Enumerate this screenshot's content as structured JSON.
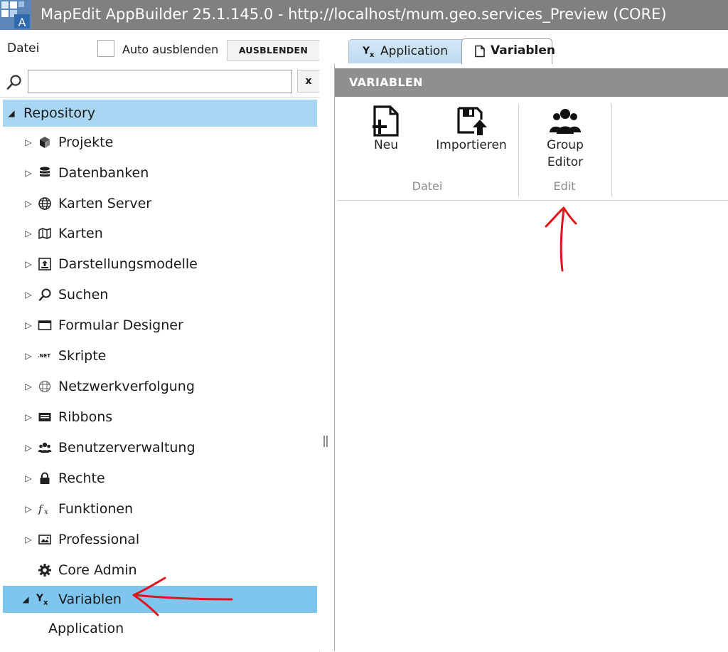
{
  "window": {
    "title": "MapEdit AppBuilder 25.1.145.0   -   http://localhost/mum.geo.services_Preview (CORE)"
  },
  "left_panel": {
    "datei_label": "Datei",
    "auto_hide_label": "Auto ausblenden",
    "hide_button": "AUSBLENDEN",
    "search_value": "",
    "clear_button": "x"
  },
  "tree": {
    "root": "Repository",
    "items": [
      {
        "label": "Projekte",
        "icon": "cube-icon"
      },
      {
        "label": "Datenbanken",
        "icon": "database-icon"
      },
      {
        "label": "Karten Server",
        "icon": "globe-icon"
      },
      {
        "label": "Karten",
        "icon": "map-icon"
      },
      {
        "label": "Darstellungsmodelle",
        "icon": "style-model-icon"
      },
      {
        "label": "Suchen",
        "icon": "search-icon"
      },
      {
        "label": "Formular Designer",
        "icon": "form-window-icon"
      },
      {
        "label": "Skripte",
        "icon": "dotnet-icon",
        "icon_text": ".NET"
      },
      {
        "label": "Netzwerkverfolgung",
        "icon": "network-grid-icon"
      },
      {
        "label": "Ribbons",
        "icon": "ribbon-icon"
      },
      {
        "label": "Benutzerverwaltung",
        "icon": "users-icon"
      },
      {
        "label": "Rechte",
        "icon": "lock-icon"
      },
      {
        "label": "Funktionen",
        "icon": "function-icon"
      },
      {
        "label": "Professional",
        "icon": "image-icon"
      },
      {
        "label": "Core Admin",
        "icon": "gear-icon"
      },
      {
        "label": "Variablen",
        "icon": "variable-icon"
      }
    ],
    "child": "Application"
  },
  "tabs": [
    {
      "label": "Application",
      "icon": "variable-icon"
    },
    {
      "label": "Variablen",
      "icon": "document-icon"
    }
  ],
  "panel": {
    "title": "VARIABLEN",
    "ribbon": {
      "buttons": [
        {
          "label": "Neu",
          "icon": "new-file-icon"
        },
        {
          "label": "Importieren",
          "icon": "import-save-icon"
        },
        {
          "label_line1": "Group",
          "label_line2": "Editor",
          "icon": "group-users-icon"
        }
      ],
      "groups": [
        "Datei",
        "Edit"
      ]
    }
  },
  "colors": {
    "titlebar": "#808080",
    "tree_selected": "#a9d6f2",
    "tree_active": "#7ec6ee",
    "panel_header": "#8f8f8f",
    "annotation": "#e0141e"
  }
}
